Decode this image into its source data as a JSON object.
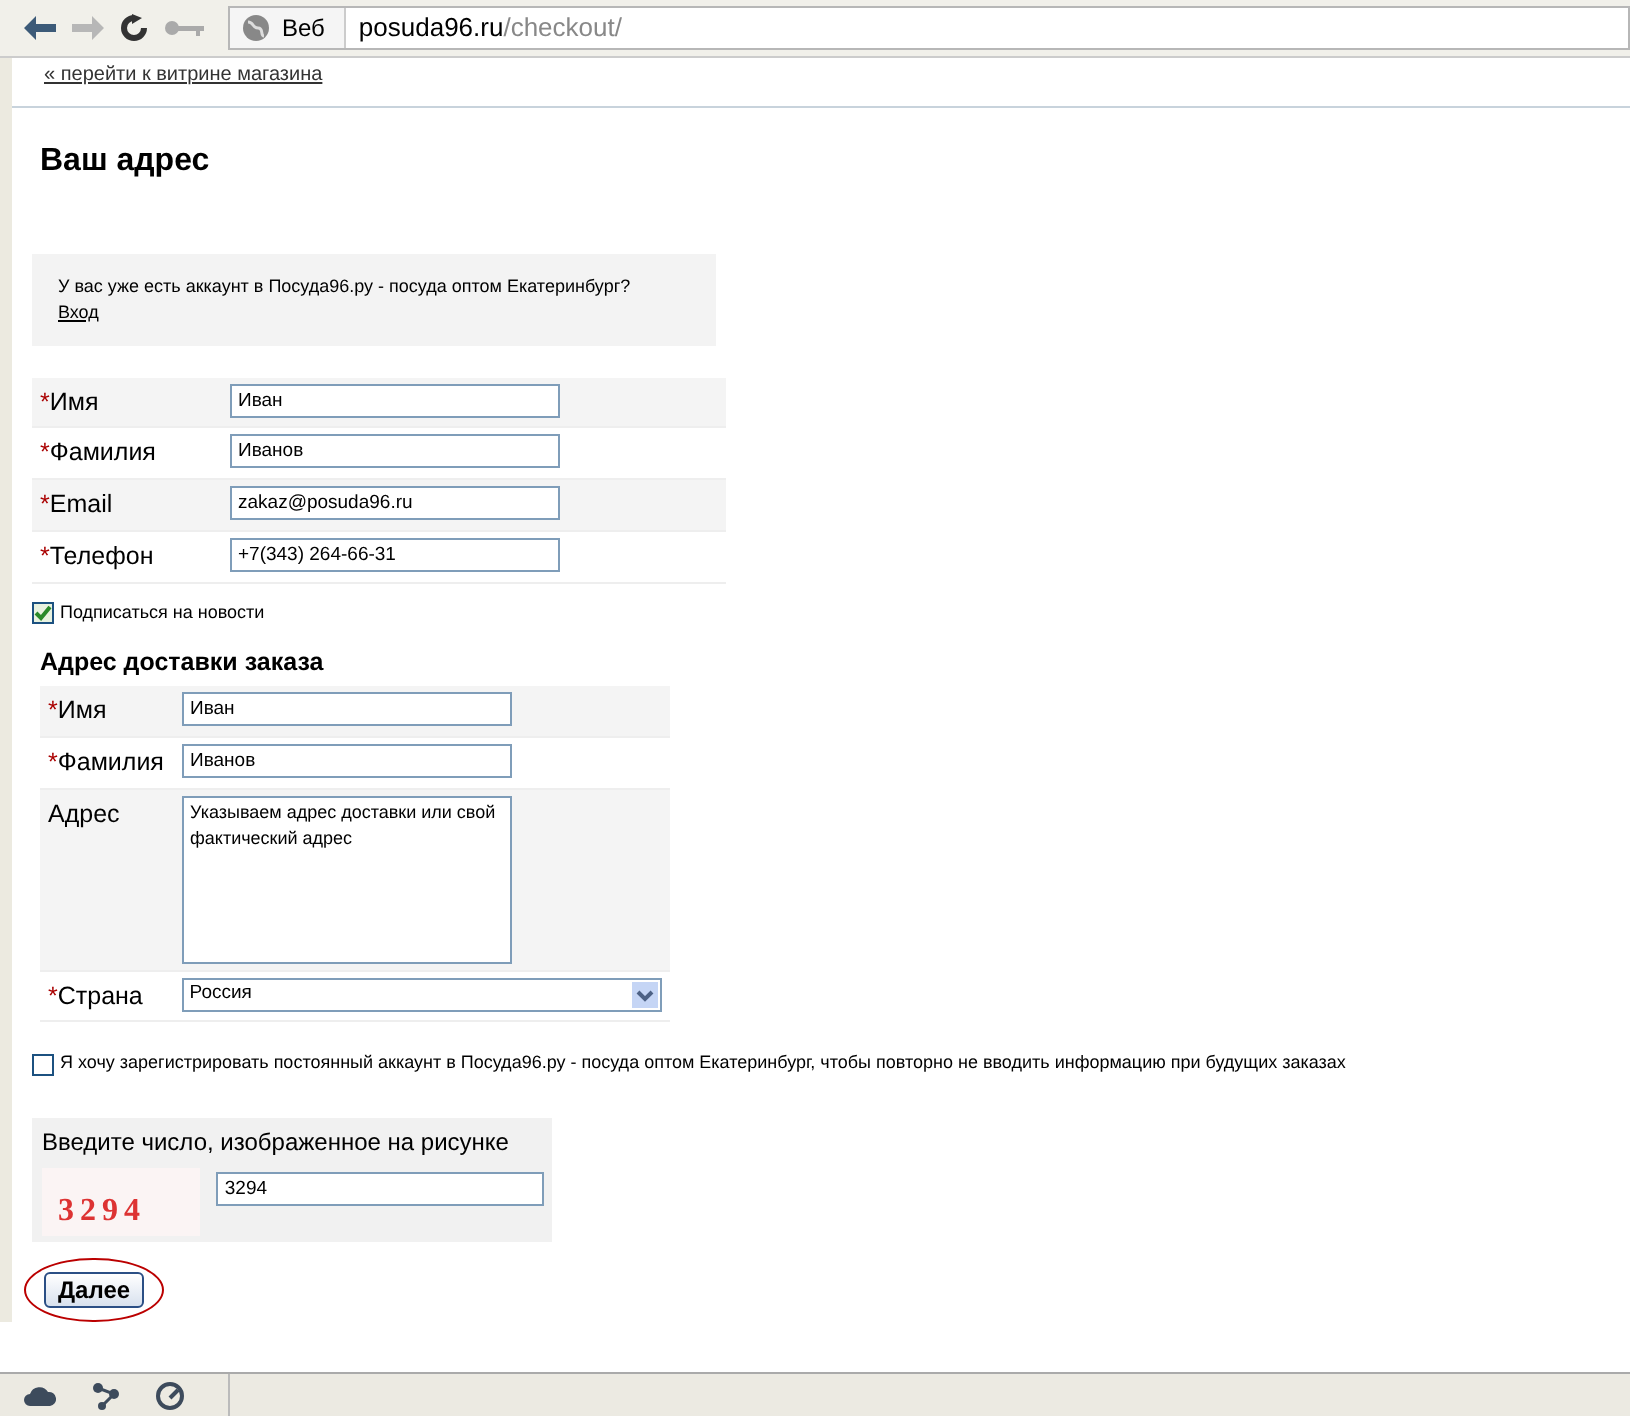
{
  "browser": {
    "search_label": "Веб",
    "url_host": "posuda96.ru",
    "url_path": "/checkout/"
  },
  "required_mark": "*",
  "back_link": "« перейти к витрине магазина",
  "title": "Ваш адрес",
  "login_box": {
    "text": "У вас уже есть аккаунт в  Посуда96.ру - посуда оптом Екатеринбург?",
    "link": "Вход"
  },
  "contact_fields": [
    {
      "label": "Имя",
      "required": true,
      "value": "Иван"
    },
    {
      "label": "Фамилия",
      "required": true,
      "value": "Иванов"
    },
    {
      "label": "Email",
      "required": true,
      "value": "zakaz@posuda96.ru"
    },
    {
      "label": "Телефон",
      "required": true,
      "value": "+7(343) 264-66-31"
    }
  ],
  "subscribe": {
    "label": "Подписаться на новости",
    "checked": true
  },
  "delivery": {
    "heading": "Адрес доставки заказа",
    "fields": [
      {
        "kind": "input",
        "label": "Имя",
        "required": true,
        "value": "Иван"
      },
      {
        "kind": "input",
        "label": "Фамилия",
        "required": true,
        "value": "Иванов"
      },
      {
        "kind": "textarea",
        "label": "Адрес",
        "required": false,
        "value": "Указываем адрес доставки или свой фактический адрес"
      },
      {
        "kind": "select",
        "label": "Страна",
        "required": true,
        "value": "Россия"
      }
    ]
  },
  "register": {
    "label": "Я хочу зарегистрировать постоянный аккаунт в  Посуда96.ру - посуда оптом Екатеринбург, чтобы повторно не вводить информацию при будущих заказах",
    "checked": false
  },
  "captcha": {
    "label": "Введите число, изображенное на рисунке",
    "image_text": "3294",
    "value": "3294"
  },
  "submit": "Далее"
}
